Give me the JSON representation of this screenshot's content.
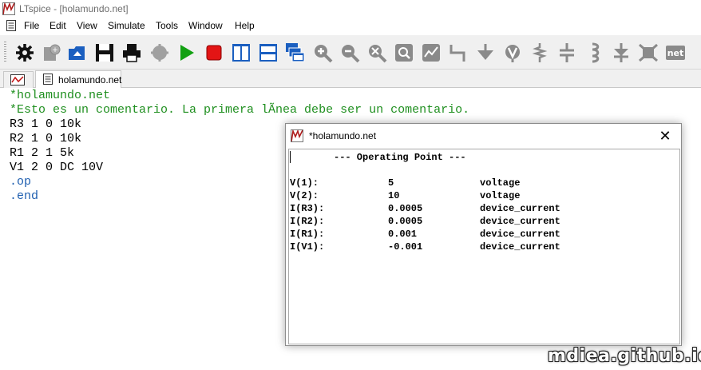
{
  "window": {
    "title": "LTspice - [holamundo.net]"
  },
  "menu": {
    "items": [
      "File",
      "Edit",
      "View",
      "Simulate",
      "Tools",
      "Window",
      "Help"
    ]
  },
  "tab": {
    "label": "holamundo.net"
  },
  "editor": {
    "lines": [
      {
        "text": "*holamundo.net",
        "kind": "comment"
      },
      {
        "text": "*Esto es un comentario. La primera lÃ­nea debe ser un comentario.",
        "kind": "comment"
      },
      {
        "text": "R3 1 0 10k",
        "kind": "component"
      },
      {
        "text": "R2 1 0 10k",
        "kind": "component"
      },
      {
        "text": "R1 2 1 5k",
        "kind": "component"
      },
      {
        "text": "V1 2 0 DC 10V",
        "kind": "component"
      },
      {
        "text": ".op",
        "kind": "directive"
      },
      {
        "text": ".end",
        "kind": "directive"
      }
    ]
  },
  "dialog": {
    "title": "*holamundo.net",
    "close_label": "✕",
    "header": "--- Operating Point ---",
    "rows": [
      {
        "name": "V(1):",
        "value": "5",
        "type": "voltage"
      },
      {
        "name": "V(2):",
        "value": "10",
        "type": "voltage"
      },
      {
        "name": "I(R3):",
        "value": "0.0005",
        "type": "device_current"
      },
      {
        "name": "I(R2):",
        "value": "0.0005",
        "type": "device_current"
      },
      {
        "name": "I(R1):",
        "value": "0.001",
        "type": "device_current"
      },
      {
        "name": "I(V1):",
        "value": "-0.001",
        "type": "device_current"
      }
    ]
  },
  "toolbar": {
    "icons": [
      "control-panel-icon",
      "new-schematic-icon",
      "open-icon",
      "save-icon",
      "print-icon",
      "halt-icon",
      "run-icon",
      "stop-icon",
      "tile-vertical-icon",
      "tile-horizontal-icon",
      "cascade-icon",
      "zoom-in-icon",
      "zoom-out-icon",
      "zoom-fit-icon",
      "zoom-extents-icon",
      "autorange-icon",
      "wire-icon",
      "ground-icon",
      "label-net-icon",
      "resistor-icon",
      "capacitor-icon",
      "inductor-icon",
      "diode-icon",
      "component-icon",
      "spice-directive-icon"
    ]
  },
  "watermark": "mdiea.github.io",
  "colors": {
    "comment": "#1f8f1f",
    "directive": "#1f5fb0",
    "toolbar_bg": "#f0f0f0",
    "icon_blue": "#1b5fc0"
  }
}
